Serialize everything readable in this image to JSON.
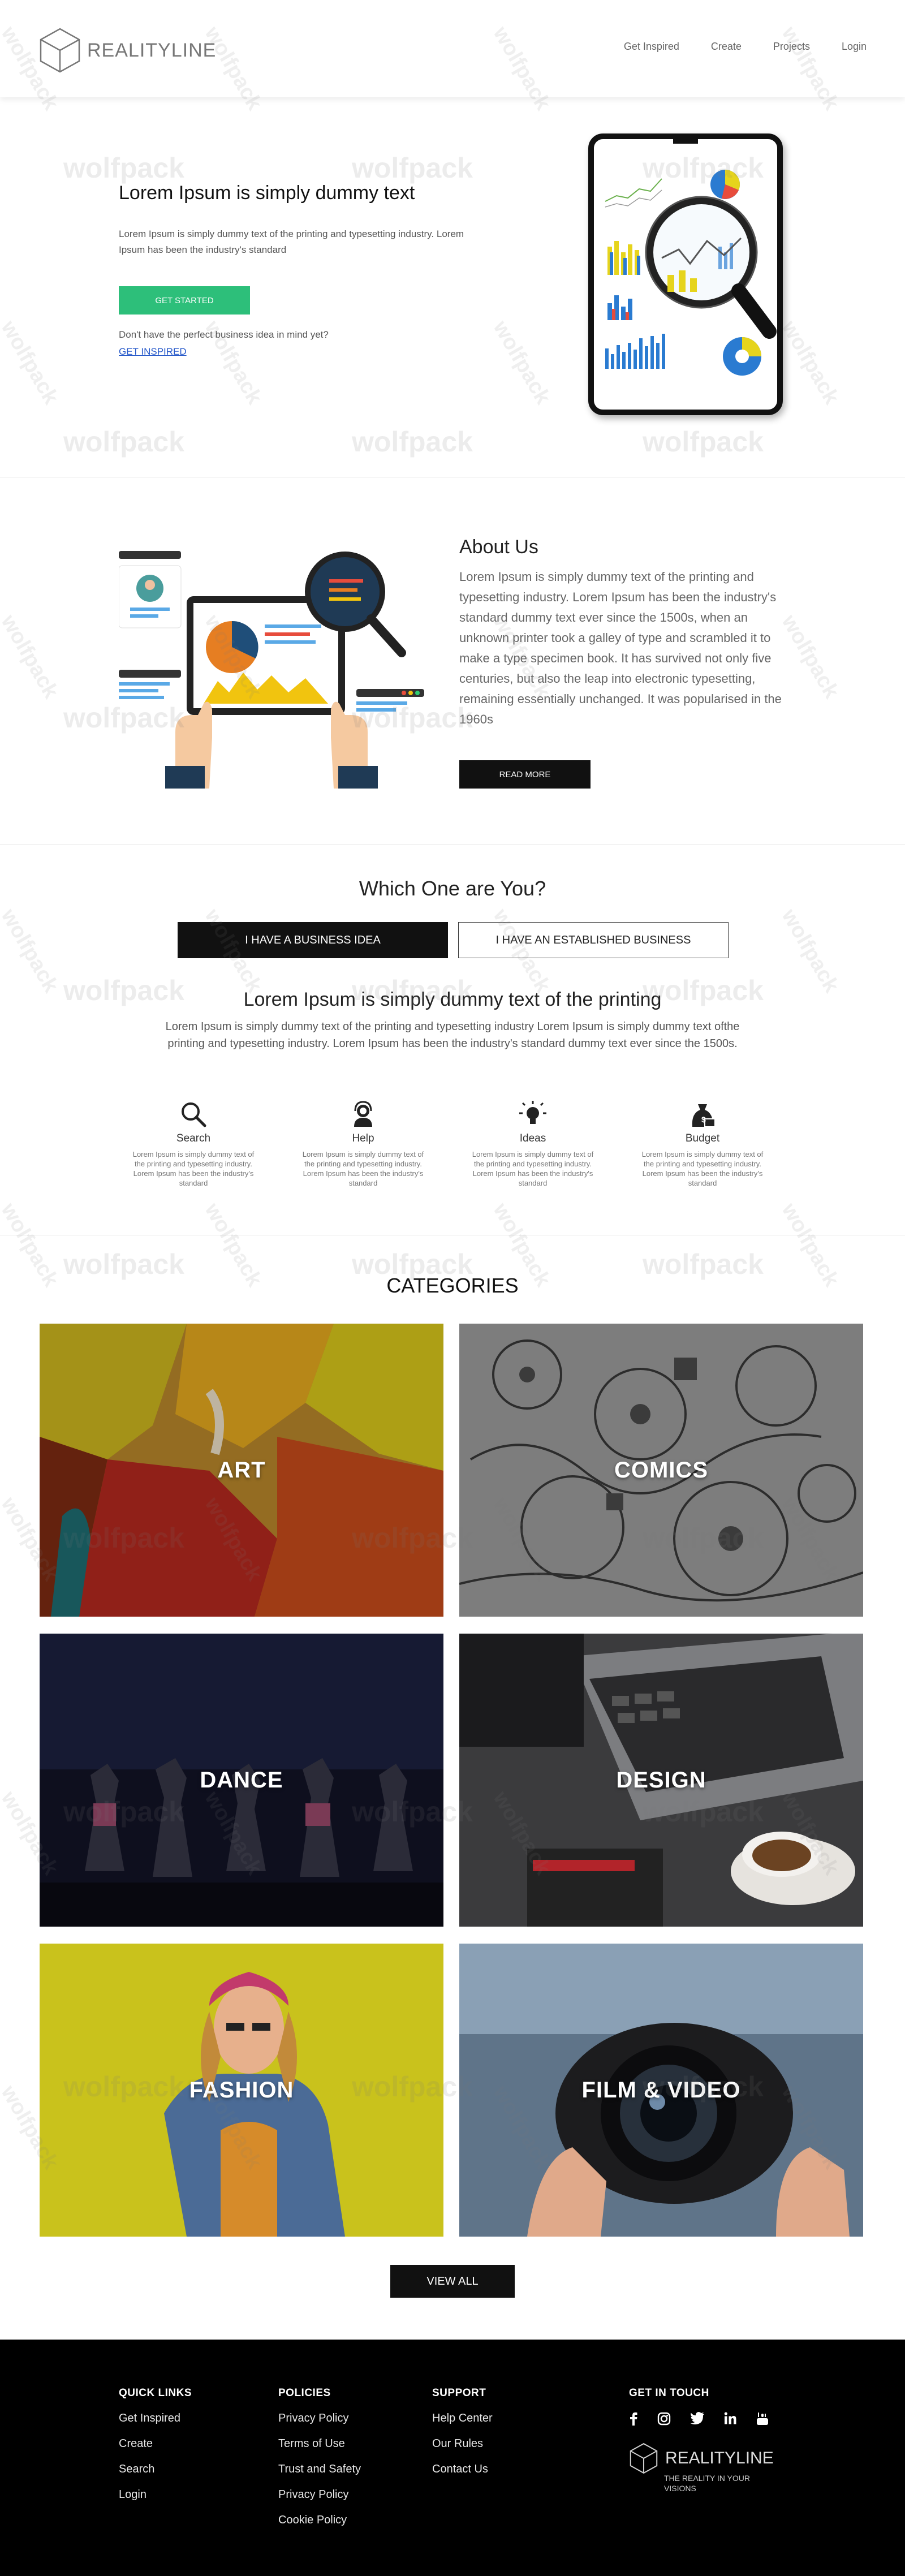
{
  "header": {
    "logo_text": "REALITYLINE",
    "nav": [
      "Get Inspired",
      "Create",
      "Projects",
      "Login"
    ]
  },
  "hero": {
    "title": "Lorem Ipsum is simply dummy text",
    "text": "Lorem Ipsum is simply dummy text of the printing and typesetting industry. Lorem Ipsum has been the industry's standard",
    "button": "GET STARTED",
    "question": "Don't have the perfect business idea in mind yet?",
    "link": "GET INSPIRED"
  },
  "about": {
    "title": "About Us",
    "text": "Lorem Ipsum is simply dummy text of the printing and typesetting industry. Lorem Ipsum has been the industry's standard dummy text ever since the 1500s, when an unknown printer took a galley of type and scrambled it to make a type specimen book. It has survived not only five centuries, but also the leap into electronic typesetting, remaining essentially unchanged. It was popularised in the 1960s",
    "button": "READ MORE"
  },
  "which": {
    "title": "Which One are You?",
    "tab_business": "I HAVE A BUSINESS IDEA",
    "tab_established": "I HAVE AN ESTABLISHED BUSINESS",
    "subtitle": "Lorem Ipsum is simply dummy text of the printing",
    "text": "Lorem Ipsum is simply dummy text of the printing and typesetting industry Lorem Ipsum is simply dummy text ofthe printing and typesetting industry. Lorem Ipsum has been the industry's standard dummy text ever since the 1500s.",
    "features": [
      {
        "label": "Search",
        "text": "Lorem Ipsum is simply dummy text of the printing and typesetting industry. Lorem Ipsum has been the industry's standard"
      },
      {
        "label": "Help",
        "text": "Lorem Ipsum is simply dummy text of the printing and typesetting industry. Lorem Ipsum has been the industry's standard"
      },
      {
        "label": "Ideas",
        "text": "Lorem Ipsum is simply dummy text of the printing and typesetting industry. Lorem Ipsum has been the industry's standard"
      },
      {
        "label": "Budget",
        "text": "Lorem Ipsum is simply dummy text of the printing and typesetting industry. Lorem Ipsum has been the industry's standard"
      }
    ]
  },
  "categories": {
    "title": "CATEGORIES",
    "items": [
      "ART",
      "COMICS",
      "DANCE",
      "DESIGN",
      "FASHION",
      "FILM & VIDEO"
    ],
    "button": "VIEW ALL"
  },
  "footer": {
    "quick_links": {
      "title": "QUICK LINKS",
      "items": [
        "Get Inspired",
        "Create",
        "Search",
        "Login"
      ]
    },
    "policies": {
      "title": "POLICIES",
      "items": [
        "Privacy Policy",
        "Terms of Use",
        "Trust and Safety",
        "Privacy Policy",
        "Cookie Policy"
      ]
    },
    "support": {
      "title": "SUPPORT",
      "items": [
        "Help Center",
        "Our Rules",
        "Contact Us"
      ]
    },
    "contact": {
      "title": "GET IN TOUCH",
      "social": [
        "facebook-icon",
        "instagram-icon",
        "twitter-icon",
        "linkedin-icon",
        "youtube-icon"
      ]
    },
    "logo_text": "REALITYLINE",
    "tagline_1": "THE REALITY IN YOUR",
    "tagline_2": "VISIONS"
  },
  "watermark": "wolfpack",
  "colors": {
    "green": "#2dbf7a",
    "link_blue": "#2457c9",
    "black": "#111111"
  }
}
